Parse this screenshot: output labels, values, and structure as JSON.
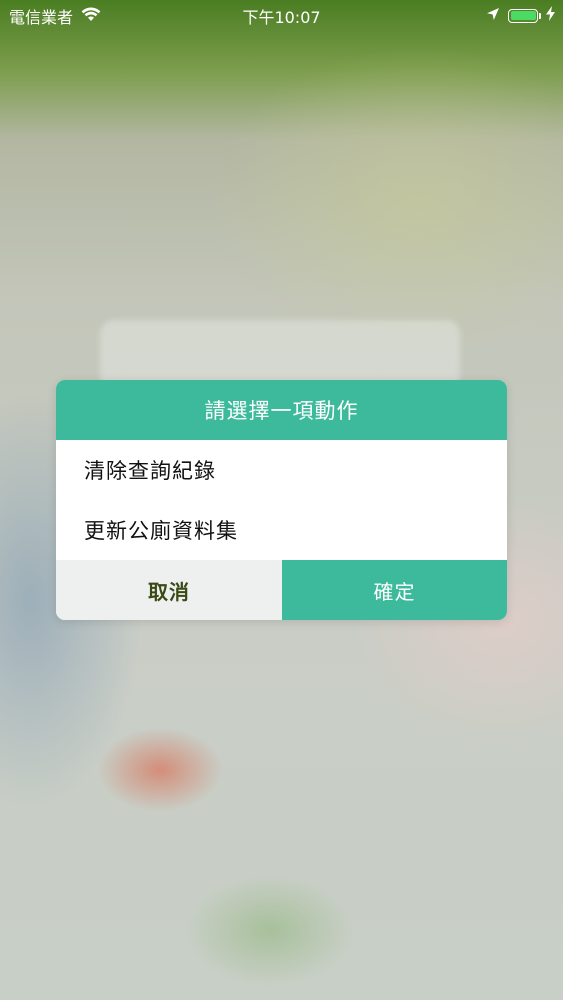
{
  "status_bar": {
    "carrier": "電信業者",
    "time": "下午10:07",
    "battery_level": 1.0,
    "battery_color": "#4cd964"
  },
  "dialog": {
    "title": "請選擇一項動作",
    "options": [
      {
        "label": "清除查詢紀錄"
      },
      {
        "label": "更新公廁資料集"
      }
    ],
    "cancel_label": "取消",
    "confirm_label": "確定",
    "accent_color": "#3cba9b"
  }
}
